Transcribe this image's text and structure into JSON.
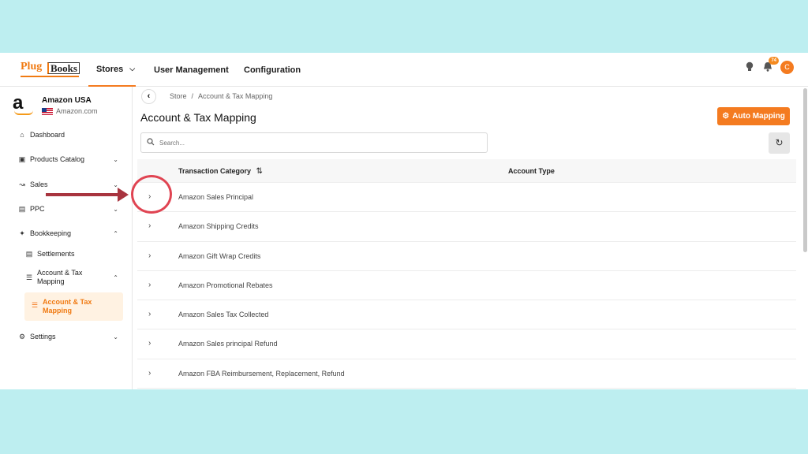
{
  "brand": {
    "plug": "Plug",
    "books": "Books"
  },
  "nav": {
    "stores": "Stores",
    "user_management": "User Management",
    "configuration": "Configuration"
  },
  "top_icons": {
    "notif_count": "74",
    "avatar_initial": "C"
  },
  "store": {
    "name": "Amazon USA",
    "marketplace": "Amazon.com"
  },
  "sidebar": {
    "dashboard": "Dashboard",
    "products_catalog": "Products Catalog",
    "sales": "Sales",
    "ppc": "PPC",
    "bookkeeping": "Bookkeeping",
    "settlements": "Settlements",
    "account_tax_mapping": "Account & Tax Mapping",
    "active_item": "Account & Tax Mapping",
    "settings": "Settings"
  },
  "breadcrumb": {
    "store": "Store",
    "sep": "/",
    "current": "Account & Tax Mapping"
  },
  "page": {
    "title": "Account & Tax Mapping",
    "auto_mapping": "Auto Mapping"
  },
  "search": {
    "placeholder": "Search..."
  },
  "table": {
    "col_category": "Transaction Category",
    "col_account_type": "Account Type",
    "rows": [
      "Amazon Sales Principal",
      "Amazon Shipping Credits",
      "Amazon Gift Wrap Credits",
      "Amazon Promotional Rebates",
      "Amazon Sales Tax Collected",
      "Amazon Sales principal Refund",
      "Amazon FBA Reimbursement, Replacement, Refund"
    ]
  },
  "colors": {
    "accent": "#f47b20",
    "annotation": "#e04452",
    "background": "#bdeef0"
  }
}
